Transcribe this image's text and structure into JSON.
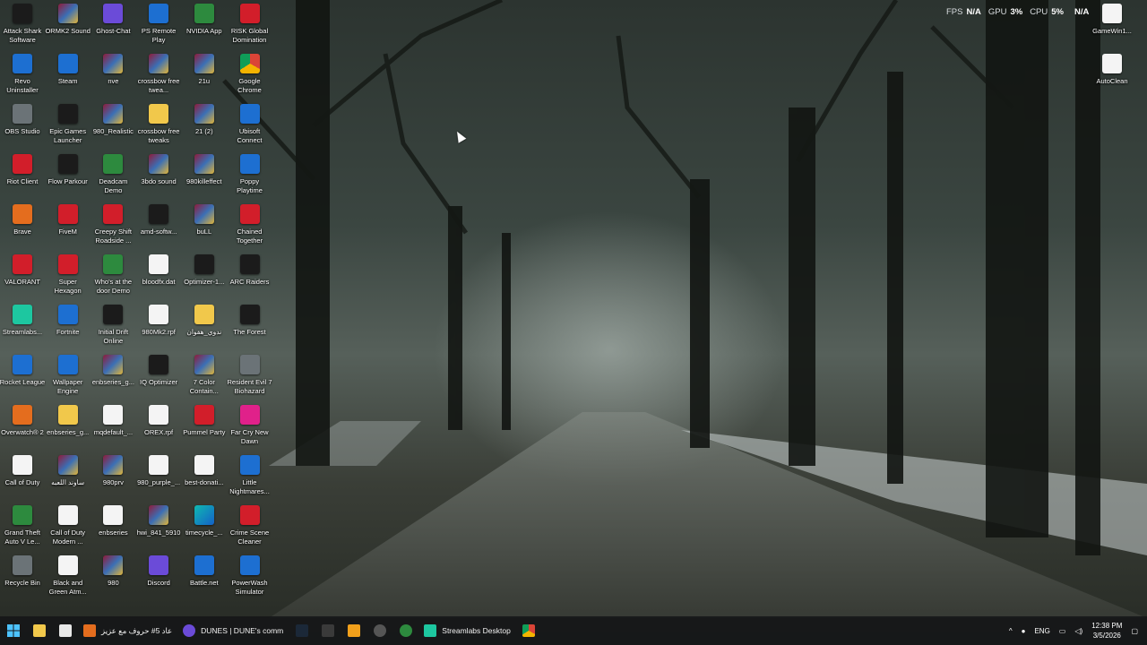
{
  "desktop_icons": [
    {
      "label": "Attack Shark Software",
      "icon": "attack-shark-icon",
      "glyph": "g-dark",
      "col": 0,
      "row": 0
    },
    {
      "label": "Revo Uninstaller",
      "icon": "revo-uninstaller-icon",
      "glyph": "g-blue",
      "col": 0,
      "row": 1
    },
    {
      "label": "OBS Studio",
      "icon": "obs-studio-icon",
      "glyph": "g-gray",
      "col": 0,
      "row": 2
    },
    {
      "label": "Riot Client",
      "icon": "riot-client-icon",
      "glyph": "g-red",
      "col": 0,
      "row": 3
    },
    {
      "label": "Brave",
      "icon": "brave-icon",
      "glyph": "g-orange",
      "col": 0,
      "row": 4
    },
    {
      "label": "VALORANT",
      "icon": "valorant-icon",
      "glyph": "g-red",
      "col": 0,
      "row": 5
    },
    {
      "label": "Streamlabs...",
      "icon": "streamlabs-icon",
      "glyph": "g-teal",
      "col": 0,
      "row": 6
    },
    {
      "label": "Rocket League",
      "icon": "rocket-league-icon",
      "glyph": "g-blue",
      "col": 0,
      "row": 7
    },
    {
      "label": "Overwatch® 2",
      "icon": "overwatch-icon",
      "glyph": "g-orange",
      "col": 0,
      "row": 8
    },
    {
      "label": "Call of Duty",
      "icon": "file-icon",
      "glyph": "g-file",
      "col": 0,
      "row": 9
    },
    {
      "label": "Grand Theft Auto V Le...",
      "icon": "gta-v-icon",
      "glyph": "g-green",
      "col": 0,
      "row": 10
    },
    {
      "label": "Recycle Bin",
      "icon": "recycle-bin-icon",
      "glyph": "g-gray",
      "col": 0,
      "row": 11
    },
    {
      "label": "ORMK2 Sound",
      "icon": "archive-icon",
      "glyph": "g-archive",
      "col": 1,
      "row": 0
    },
    {
      "label": "Steam",
      "icon": "steam-icon",
      "glyph": "g-blue",
      "col": 1,
      "row": 1
    },
    {
      "label": "Epic Games Launcher",
      "icon": "epic-games-icon",
      "glyph": "g-dark",
      "col": 1,
      "row": 2
    },
    {
      "label": "Flow Parkour",
      "icon": "flow-parkour-icon",
      "glyph": "g-dark",
      "col": 1,
      "row": 3
    },
    {
      "label": "FiveM",
      "icon": "fivem-icon",
      "glyph": "g-red",
      "col": 1,
      "row": 4
    },
    {
      "label": "Super Hexagon",
      "icon": "super-hexagon-icon",
      "glyph": "g-red",
      "col": 1,
      "row": 5
    },
    {
      "label": "Fortnite",
      "icon": "fortnite-icon",
      "glyph": "g-blue",
      "col": 1,
      "row": 6
    },
    {
      "label": "Wallpaper Engine",
      "icon": "wallpaper-engine-icon",
      "glyph": "g-blue",
      "col": 1,
      "row": 7
    },
    {
      "label": "enbseries_g...",
      "icon": "folder-icon",
      "glyph": "g-folder",
      "col": 1,
      "row": 8
    },
    {
      "label": "ساوند اللعبه",
      "icon": "archive-icon",
      "glyph": "g-archive",
      "col": 1,
      "row": 9
    },
    {
      "label": "Call of Duty Modern ...",
      "icon": "file-icon",
      "glyph": "g-file",
      "col": 1,
      "row": 10
    },
    {
      "label": "Black and Green Atm...",
      "icon": "image-file-icon",
      "glyph": "g-file",
      "col": 1,
      "row": 11
    },
    {
      "label": "Ghost-Chat",
      "icon": "ghost-chat-icon",
      "glyph": "g-purple",
      "col": 2,
      "row": 0
    },
    {
      "label": "nve",
      "icon": "archive-icon",
      "glyph": "g-archive",
      "col": 2,
      "row": 1
    },
    {
      "label": "980_Realistic",
      "icon": "archive-icon",
      "glyph": "g-archive",
      "col": 2,
      "row": 2
    },
    {
      "label": "Deadcam Demo",
      "icon": "deadcam-icon",
      "glyph": "g-green",
      "col": 2,
      "row": 3
    },
    {
      "label": "Creepy Shift Roadside ...",
      "icon": "creepy-shift-icon",
      "glyph": "g-red",
      "col": 2,
      "row": 4
    },
    {
      "label": "Who's at the door Demo",
      "icon": "whos-at-door-icon",
      "glyph": "g-green",
      "col": 2,
      "row": 5
    },
    {
      "label": "Initial Drift Online",
      "icon": "initial-drift-icon",
      "glyph": "g-dark",
      "col": 2,
      "row": 6
    },
    {
      "label": "enbseries_g...",
      "icon": "archive-icon",
      "glyph": "g-archive",
      "col": 2,
      "row": 7
    },
    {
      "label": "mqdefault_...",
      "icon": "file-icon",
      "glyph": "g-file",
      "col": 2,
      "row": 8
    },
    {
      "label": "980prv",
      "icon": "archive-icon",
      "glyph": "g-archive",
      "col": 2,
      "row": 9
    },
    {
      "label": "enbseries",
      "icon": "gear-file-icon",
      "glyph": "g-file",
      "col": 2,
      "row": 10
    },
    {
      "label": "980",
      "icon": "archive-icon",
      "glyph": "g-archive",
      "col": 2,
      "row": 11
    },
    {
      "label": "PS Remote Play",
      "icon": "ps-remote-play-icon",
      "glyph": "g-blue",
      "col": 3,
      "row": 0
    },
    {
      "label": "crossbow free twea...",
      "icon": "archive-icon",
      "glyph": "g-archive",
      "col": 3,
      "row": 1
    },
    {
      "label": "crossbow free tweaks",
      "icon": "folder-icon",
      "glyph": "g-folder",
      "col": 3,
      "row": 2
    },
    {
      "label": "3bdo sound",
      "icon": "archive-icon",
      "glyph": "g-archive",
      "col": 3,
      "row": 3
    },
    {
      "label": "amd-softw...",
      "icon": "amd-software-icon",
      "glyph": "g-dark",
      "col": 3,
      "row": 4
    },
    {
      "label": "bloodfx.dat",
      "icon": "file-icon",
      "glyph": "g-file",
      "col": 3,
      "row": 5
    },
    {
      "label": "980Mk2.rpf",
      "icon": "file-icon",
      "glyph": "g-file",
      "col": 3,
      "row": 6
    },
    {
      "label": "IQ Optimizer",
      "icon": "iq-optimizer-icon",
      "glyph": "g-dark",
      "col": 3,
      "row": 7
    },
    {
      "label": "OREX.rpf",
      "icon": "file-icon",
      "glyph": "g-file",
      "col": 3,
      "row": 8
    },
    {
      "label": "980_purple_...",
      "icon": "file-icon",
      "glyph": "g-file",
      "col": 3,
      "row": 9
    },
    {
      "label": "hwi_841_5910",
      "icon": "archive-icon",
      "glyph": "g-archive",
      "col": 3,
      "row": 10
    },
    {
      "label": "Discord",
      "icon": "discord-icon",
      "glyph": "g-purple",
      "col": 3,
      "row": 11
    },
    {
      "label": "NVIDIA App",
      "icon": "nvidia-icon",
      "glyph": "g-green",
      "col": 4,
      "row": 0
    },
    {
      "label": "21u",
      "icon": "archive-icon",
      "glyph": "g-archive",
      "col": 4,
      "row": 1
    },
    {
      "label": "21 (2)",
      "icon": "archive-icon",
      "glyph": "g-archive",
      "col": 4,
      "row": 2
    },
    {
      "label": "980killeffect",
      "icon": "archive-icon",
      "glyph": "g-archive",
      "col": 4,
      "row": 3
    },
    {
      "label": "buLL",
      "icon": "archive-icon",
      "glyph": "g-archive",
      "col": 4,
      "row": 4
    },
    {
      "label": "Optimizer-1...",
      "icon": "optimizer-icon",
      "glyph": "g-dark",
      "col": 4,
      "row": 5
    },
    {
      "label": "ندوي_هقوان",
      "icon": "folder-icon",
      "glyph": "g-folder",
      "col": 4,
      "row": 6
    },
    {
      "label": "7 Color Contain...",
      "icon": "archive-icon",
      "glyph": "g-archive",
      "col": 4,
      "row": 7
    },
    {
      "label": "Pummel Party",
      "icon": "pummel-party-icon",
      "glyph": "g-red",
      "col": 4,
      "row": 8
    },
    {
      "label": "best-donati...",
      "icon": "video-file-icon",
      "glyph": "g-file",
      "col": 4,
      "row": 9
    },
    {
      "label": "timecycle_...",
      "icon": "edge-icon",
      "glyph": "g-edge",
      "col": 4,
      "row": 10
    },
    {
      "label": "Battle.net",
      "icon": "battle-net-icon",
      "glyph": "g-blue",
      "col": 4,
      "row": 11
    },
    {
      "label": "RISK Global Domination",
      "icon": "risk-icon",
      "glyph": "g-red",
      "col": 5,
      "row": 0
    },
    {
      "label": "Google Chrome",
      "icon": "chrome-icon",
      "glyph": "g-chrome",
      "col": 5,
      "row": 1
    },
    {
      "label": "Ubisoft Connect",
      "icon": "ubisoft-connect-icon",
      "glyph": "g-blue",
      "col": 5,
      "row": 2
    },
    {
      "label": "Poppy Playtime",
      "icon": "poppy-playtime-icon",
      "glyph": "g-blue",
      "col": 5,
      "row": 3
    },
    {
      "label": "Chained Together",
      "icon": "chained-together-icon",
      "glyph": "g-red",
      "col": 5,
      "row": 4
    },
    {
      "label": "ARC Raiders",
      "icon": "arc-raiders-icon",
      "glyph": "g-dark",
      "col": 5,
      "row": 5
    },
    {
      "label": "The Forest",
      "icon": "the-forest-icon",
      "glyph": "g-dark",
      "col": 5,
      "row": 6
    },
    {
      "label": "Resident Evil 7 Biohazard",
      "icon": "resident-evil-icon",
      "glyph": "g-gray",
      "col": 5,
      "row": 7
    },
    {
      "label": "Far Cry New Dawn",
      "icon": "far-cry-icon",
      "glyph": "g-pink",
      "col": 5,
      "row": 8
    },
    {
      "label": "Little Nightmares...",
      "icon": "little-nightmares-icon",
      "glyph": "g-blue",
      "col": 5,
      "row": 9
    },
    {
      "label": "Crime Scene Cleaner",
      "icon": "crime-scene-cleaner-icon",
      "glyph": "g-red",
      "col": 5,
      "row": 10
    },
    {
      "label": "PowerWash Simulator",
      "icon": "powerwash-icon",
      "glyph": "g-blue",
      "col": 5,
      "row": 11
    },
    {
      "label": "GameWin1...",
      "icon": "gamewin-icon",
      "glyph": "g-file",
      "col": "r",
      "row": 0
    },
    {
      "label": "AutoClean",
      "icon": "autoclean-icon",
      "glyph": "g-file",
      "col": "r",
      "row": 1
    }
  ],
  "perf_overlay": {
    "fps_label": "FPS",
    "fps_value": "N/A",
    "gpu_label": "GPU",
    "gpu_value": "3%",
    "cpu_label": "CPU",
    "cpu_value": "5%",
    "extra_value": "N/A"
  },
  "taskbar": {
    "apps": [
      {
        "label": "عاد 5# حروف مع عزيز",
        "icon": "brave-icon",
        "color": "#e46d1e"
      },
      {
        "label": "DUNES | DUNE's comm",
        "icon": "discord-icon",
        "color": "#6b4bd8"
      },
      {
        "label": "Streamlabs Desktop",
        "icon": "streamlabs-icon",
        "color": "#1dc7a0"
      }
    ],
    "tray": {
      "language": "ENG",
      "time": "12:38 PM",
      "date": "3/5/2026"
    }
  }
}
